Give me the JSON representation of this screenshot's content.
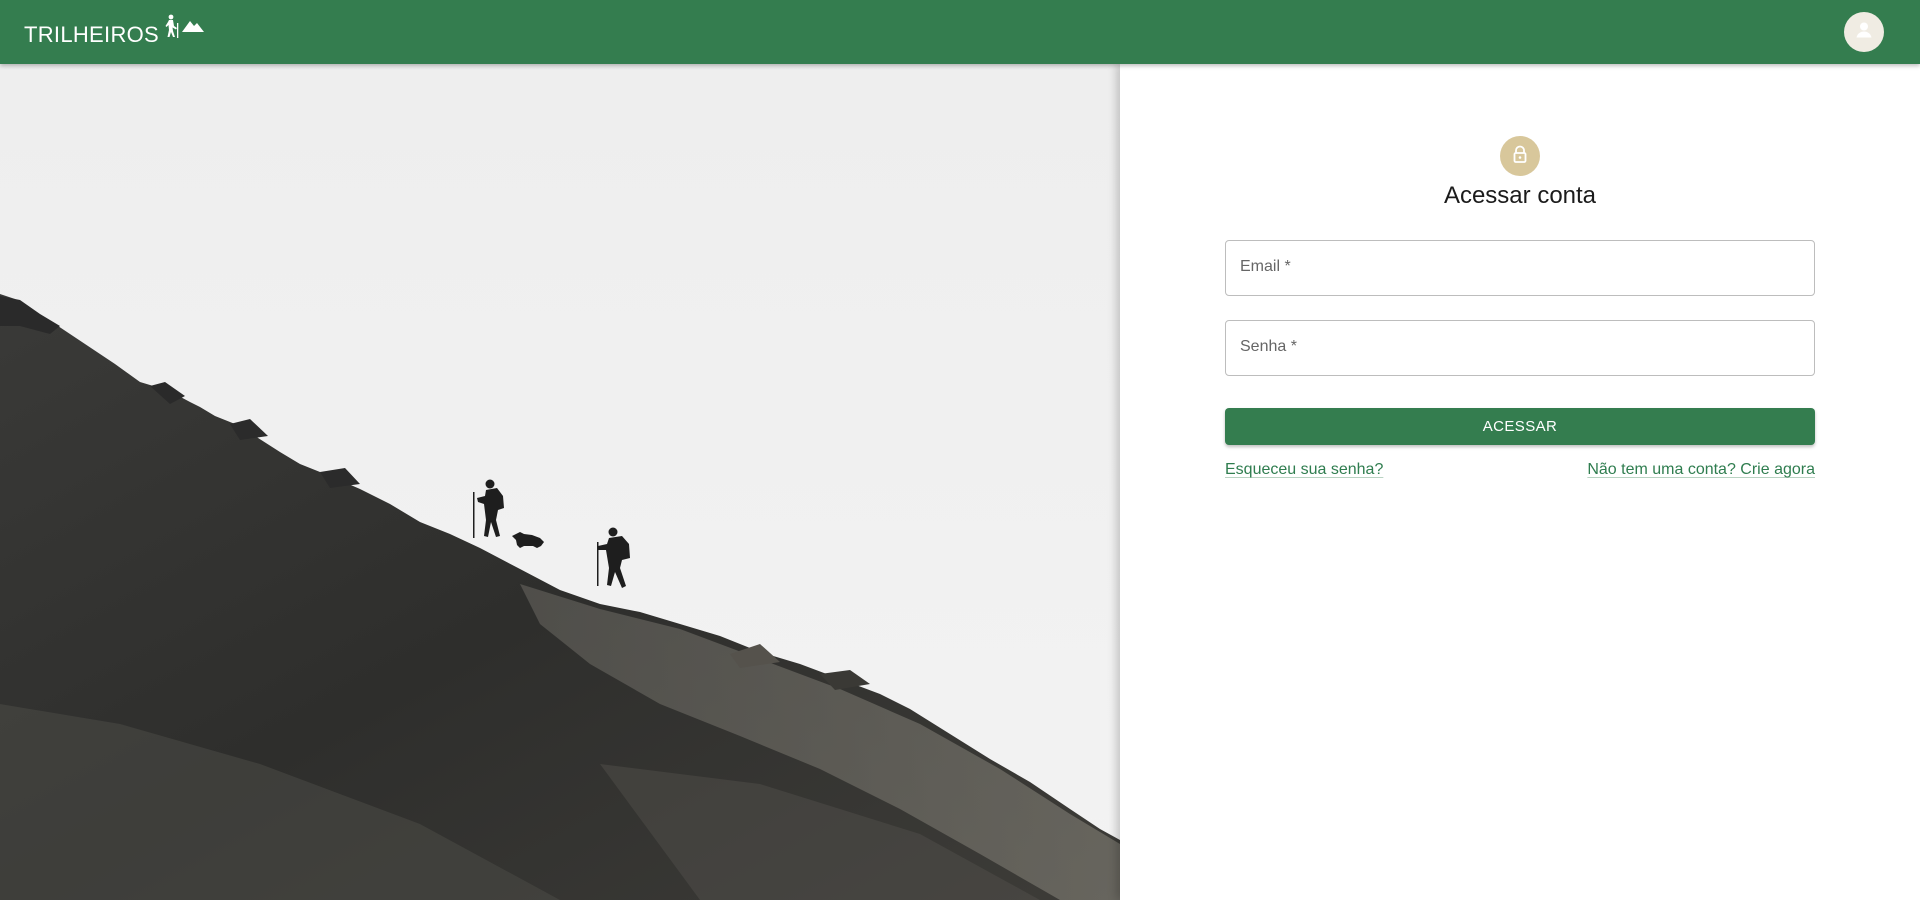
{
  "app": {
    "brand": "TRILHEIROS",
    "brand_icons": [
      "hiker-icon",
      "mountain-icon"
    ],
    "avatar_icon": "person-icon"
  },
  "colors": {
    "primary": "#347d4f",
    "lock_badge": "#d8c79b",
    "link": "#2f7d4f"
  },
  "hero": {
    "image": "black-and-white photo of two hikers and a dog climbing a steep grassy slope"
  },
  "login": {
    "icon": "lock-icon",
    "title": "Acessar conta",
    "email_label": "Email *",
    "email_value": "",
    "senha_label": "Senha *",
    "senha_value": "",
    "submit_label": "ACESSAR",
    "forgot_link": "Esqueceu sua senha?",
    "signup_link": "Não tem uma conta? Crie agora"
  }
}
